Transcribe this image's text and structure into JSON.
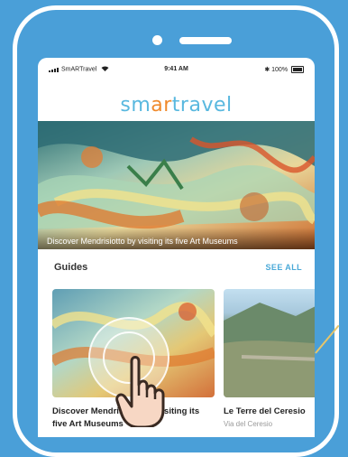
{
  "status_bar": {
    "carrier": "SmARTravel",
    "time": "9:41 AM",
    "battery": "100%"
  },
  "app": {
    "logo_part1": "sm",
    "logo_part2": "ar",
    "logo_part3": "travel"
  },
  "hero": {
    "caption": "Discover Mendrisiotto by visiting its five Art Museums"
  },
  "guides": {
    "title": "Guides",
    "see_all": "SEE ALL",
    "cards": [
      {
        "title": "Discover Mendrisiotto by visiting its five Art Museums",
        "subtitle": ""
      },
      {
        "title": "Le Terre del Ceresio",
        "subtitle": "Via del Ceresio"
      }
    ]
  },
  "colors": {
    "background": "#4a9fd8",
    "accent_blue": "#59b8df",
    "accent_orange": "#f08a2c",
    "see_all": "#4aa9d8"
  },
  "icons": [
    "signal-bars-icon",
    "wifi-icon",
    "bluetooth-icon",
    "battery-icon",
    "hand-pointer-icon"
  ]
}
